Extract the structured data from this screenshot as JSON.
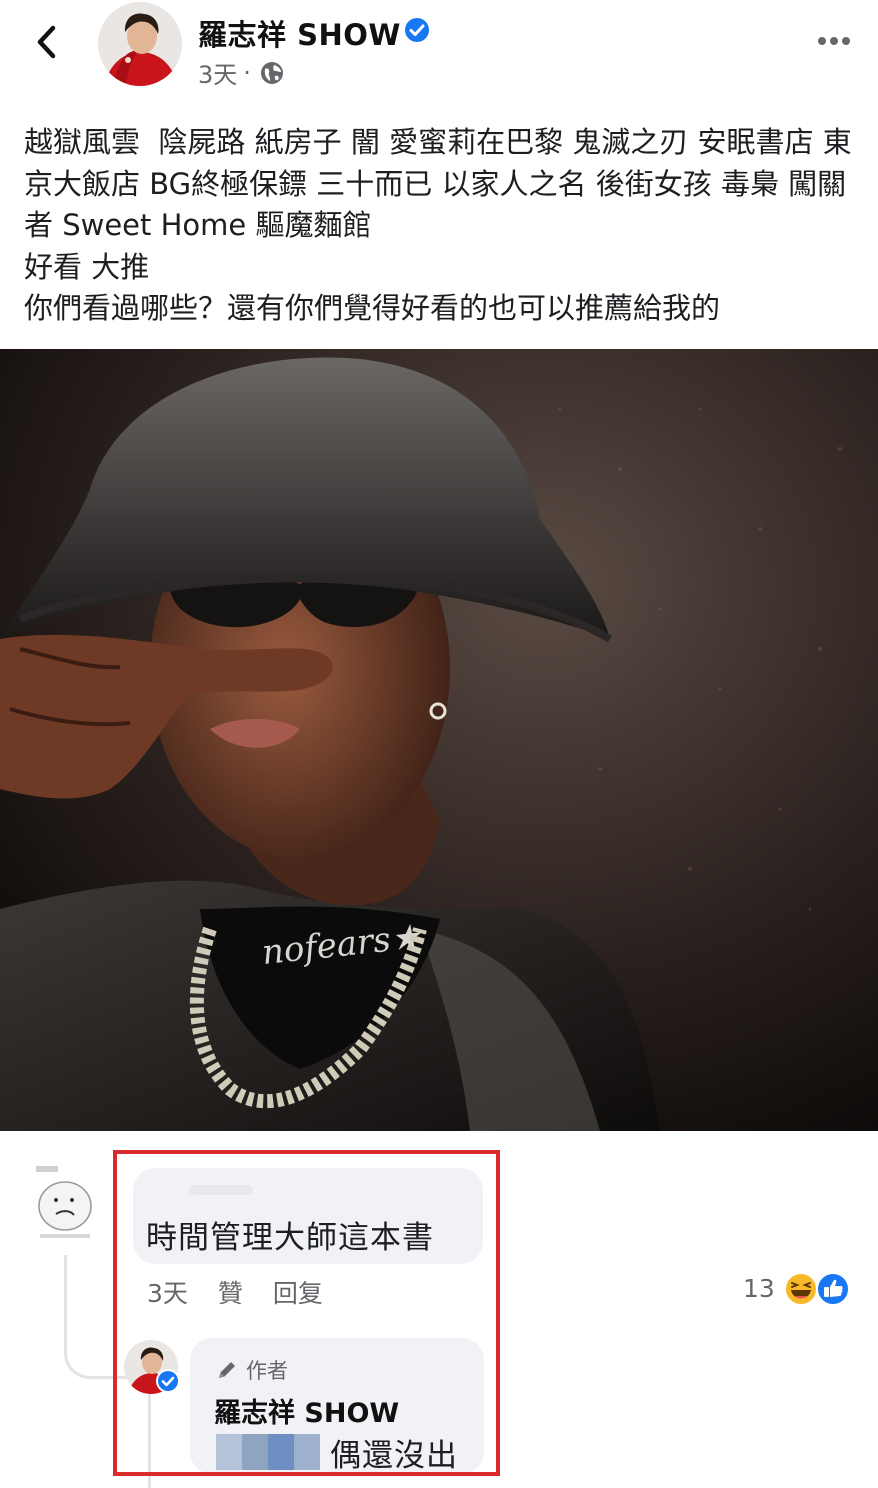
{
  "post": {
    "author": "羅志祥 SHOW",
    "time": "3天",
    "dot": "·",
    "caption": "越獄風雲  陰屍路 紙房子 闇 愛蜜莉在巴黎 鬼滅之刃 安眠書店 東京大飯店 BG終極保鏢 三十而已 以家人之名 後街女孩 毒梟 闖關者 Sweet Home 驅魔麵館\n好看 大推\n你們看過哪些？還有你們覺得好看的也可以推薦給我的",
    "photo_text": "nofears★"
  },
  "comment": {
    "text": "時間管理大師這本書",
    "time": "3天",
    "like_label": "贊",
    "reply_label": "回复",
    "reaction_count": "13"
  },
  "reply": {
    "badge": "作者",
    "name": "羅志祥 SHOW",
    "text": "偶還沒出"
  },
  "colors": {
    "verified_blue": "#1877f2",
    "highlight_red": "#d92b2b",
    "bubble_gray": "#f0f2f5",
    "meta_gray": "#65676b"
  },
  "icons": [
    "chevron-left-icon",
    "verified-icon",
    "globe-icon",
    "more-icon",
    "pencil-icon",
    "haha-reaction-icon",
    "like-reaction-icon"
  ]
}
